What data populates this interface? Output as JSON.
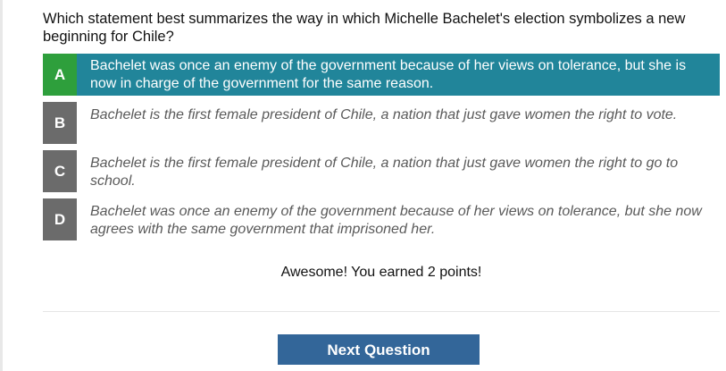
{
  "question": "Which statement best summarizes the way in which Michelle Bachelet's election symbolizes a new beginning for Chile?",
  "options": [
    {
      "letter": "A",
      "text": "Bachelet was once an enemy of the government because of her views on tolerance, but she is now in charge of the government for the same reason.",
      "selected": true
    },
    {
      "letter": "B",
      "text": "Bachelet is the first female president of Chile, a nation that just gave women the right to vote.",
      "selected": false
    },
    {
      "letter": "C",
      "text": "Bachelet is the first female president of Chile, a nation that just gave women the right to go to school.",
      "selected": false
    },
    {
      "letter": "D",
      "text": "Bachelet was once an enemy of the government because of her views on tolerance, but she now agrees with the same government that imprisoned her.",
      "selected": false
    }
  ],
  "result_message": "Awesome! You earned 2 points!",
  "next_button_label": "Next Question",
  "colors": {
    "selected_option_bg": "#21859a",
    "correct_letter_bg": "#2e9f3c",
    "unselected_letter_bg": "#6b6b6b",
    "button_bg": "#336699"
  }
}
